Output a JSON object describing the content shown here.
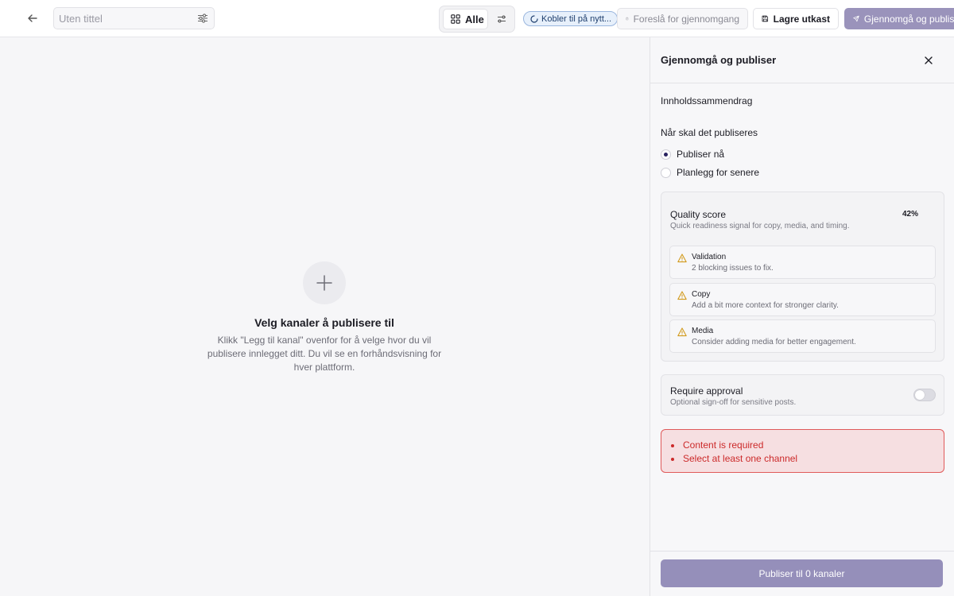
{
  "header": {
    "title_placeholder": "Uten tittel",
    "view_all_label": "Alle",
    "status_label": "Kobler til på nytt...",
    "suggest_label": "Foreslå for gjennomgang",
    "save_label": "Lagre utkast",
    "review_label": "Gjennomgå og publiser"
  },
  "canvas": {
    "empty_title": "Velg kanaler å publisere til",
    "empty_description": "Klikk \"Legg til kanal\" ovenfor for å velge hvor du vil publisere innlegget ditt. Du vil se en forhåndsvisning for hver plattform."
  },
  "panel": {
    "title": "Gjennomgå og publiser",
    "content_summary_label": "Innholdssammendrag",
    "when_label": "Når skal det publiseres",
    "options": [
      {
        "label": "Publiser nå",
        "checked": true
      },
      {
        "label": "Planlegg for senere",
        "checked": false
      }
    ],
    "quality": {
      "title": "Quality score",
      "subtitle": "Quick readiness signal for copy, media, and timing.",
      "score": "42%",
      "items": [
        {
          "title": "Validation",
          "description": "2 blocking issues to fix."
        },
        {
          "title": "Copy",
          "description": "Add a bit more context for stronger clarity."
        },
        {
          "title": "Media",
          "description": "Consider adding media for better engagement."
        }
      ]
    },
    "approval": {
      "title": "Require approval",
      "subtitle": "Optional sign-off for sensitive posts.",
      "enabled": false
    },
    "errors": [
      "Content is required",
      "Select at least one channel"
    ],
    "publish_label": "Publiser til 0 kanaler"
  },
  "colors": {
    "accent": "#958fba",
    "error": "#cc2a2a",
    "warning": "#d29a1c",
    "status_pill": "#e7f0fb"
  },
  "icons": {
    "back": "arrow-left-icon",
    "sliders": "sliders-icon",
    "grid": "grid-icon",
    "filter": "filter-icon",
    "spinner": "spinner-icon",
    "clipboard": "clipboard-check-icon",
    "save": "floppy-disk-icon",
    "send": "send-icon",
    "plus": "plus-icon",
    "close": "close-icon",
    "warning": "warning-triangle-icon"
  }
}
